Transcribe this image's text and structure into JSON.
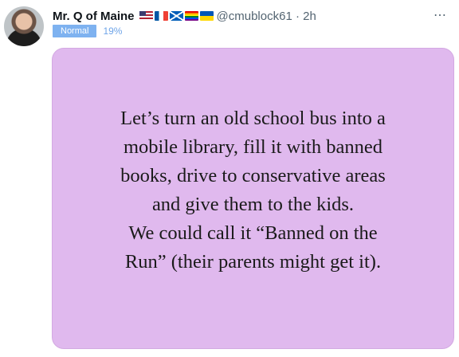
{
  "tweet": {
    "display_name": "Mr. Q of Maine",
    "flags": [
      "us-flag-icon",
      "france-flag-icon",
      "scotland-flag-icon",
      "rainbow-flag-icon",
      "ukraine-flag-icon"
    ],
    "handle": "@cmublock61 · 2h",
    "badge": "Normal",
    "percent": "19%",
    "more_icon": "more-icon",
    "image_text": [
      "Let’s turn an old school bus into a",
      "mobile library, fill it with banned",
      "books, drive to conservative areas",
      "and give them to the kids.",
      "We could call it “Banned on the",
      "Run” (their parents might get it)."
    ],
    "image_background": "#e0b9ee"
  }
}
